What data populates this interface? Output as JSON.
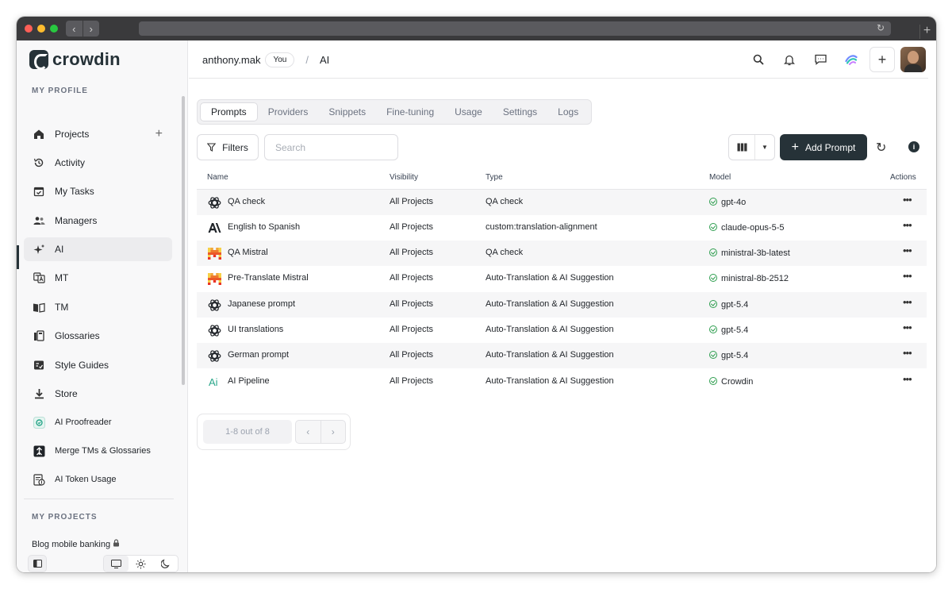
{
  "app": {
    "name": "crowdin"
  },
  "sidebar": {
    "section_profile": "MY PROFILE",
    "items": [
      {
        "label": "Projects",
        "icon": "home-icon"
      },
      {
        "label": "Activity",
        "icon": "history-icon"
      },
      {
        "label": "My Tasks",
        "icon": "calendar-check-icon"
      },
      {
        "label": "Managers",
        "icon": "people-icon"
      },
      {
        "label": "AI",
        "icon": "sparkle-icon",
        "active": true
      },
      {
        "label": "MT",
        "icon": "translate-icon"
      },
      {
        "label": "TM",
        "icon": "book-icon"
      },
      {
        "label": "Glossaries",
        "icon": "glossary-icon"
      },
      {
        "label": "Style Guides",
        "icon": "style-guide-icon"
      },
      {
        "label": "Store",
        "icon": "download-icon"
      },
      {
        "label": "AI Proofreader",
        "icon": "ai-proofreader-icon"
      },
      {
        "label": "Merge TMs & Glossaries",
        "icon": "merge-icon"
      },
      {
        "label": "AI Token Usage",
        "icon": "token-usage-icon"
      }
    ],
    "section_projects": "MY PROJECTS",
    "projects": [
      {
        "label": "Blog mobile banking",
        "icon": "lock-icon"
      }
    ]
  },
  "header": {
    "user": "anthony.mak",
    "user_badge": "You",
    "separator": "/",
    "page": "AI"
  },
  "tabs": [
    "Prompts",
    "Providers",
    "Snippets",
    "Fine-tuning",
    "Usage",
    "Settings",
    "Logs"
  ],
  "active_tab": "Prompts",
  "toolbar": {
    "filters_label": "Filters",
    "search_placeholder": "Search",
    "add_label": "Add Prompt"
  },
  "table": {
    "columns": {
      "name": "Name",
      "visibility": "Visibility",
      "type": "Type",
      "model": "Model",
      "actions": "Actions"
    },
    "rows": [
      {
        "name": "QA check",
        "visibility": "All Projects",
        "type": "QA check",
        "model": "gpt-4o",
        "icon": "openai-icon"
      },
      {
        "name": "English to Spanish",
        "visibility": "All Projects",
        "type": "custom:translation-alignment",
        "model": "claude-opus-5-5",
        "icon": "anthropic-icon"
      },
      {
        "name": "QA Mistral",
        "visibility": "All Projects",
        "type": "QA check",
        "model": "ministral-3b-latest",
        "icon": "mistral-icon"
      },
      {
        "name": "Pre-Translate Mistral",
        "visibility": "All Projects",
        "type": "Auto-Translation & AI Suggestion",
        "model": "ministral-8b-2512",
        "icon": "mistral-icon"
      },
      {
        "name": "Japanese prompt",
        "visibility": "All Projects",
        "type": "Auto-Translation & AI Suggestion",
        "model": "gpt-5.4",
        "icon": "openai-icon"
      },
      {
        "name": "UI translations",
        "visibility": "All Projects",
        "type": "Auto-Translation & AI Suggestion",
        "model": "gpt-5.4",
        "icon": "openai-icon"
      },
      {
        "name": "German prompt",
        "visibility": "All Projects",
        "type": "Auto-Translation & AI Suggestion",
        "model": "gpt-5.4",
        "icon": "openai-icon"
      },
      {
        "name": "AI Pipeline",
        "visibility": "All Projects",
        "type": "Auto-Translation & AI Suggestion",
        "model": "Crowdin",
        "icon": "ai-pipeline-icon"
      }
    ]
  },
  "pagination": {
    "info": "1-8 out of 8"
  },
  "colors": {
    "primary": "#263238",
    "success": "#2e9e4f",
    "ai_pipeline": "#2aa68a"
  }
}
